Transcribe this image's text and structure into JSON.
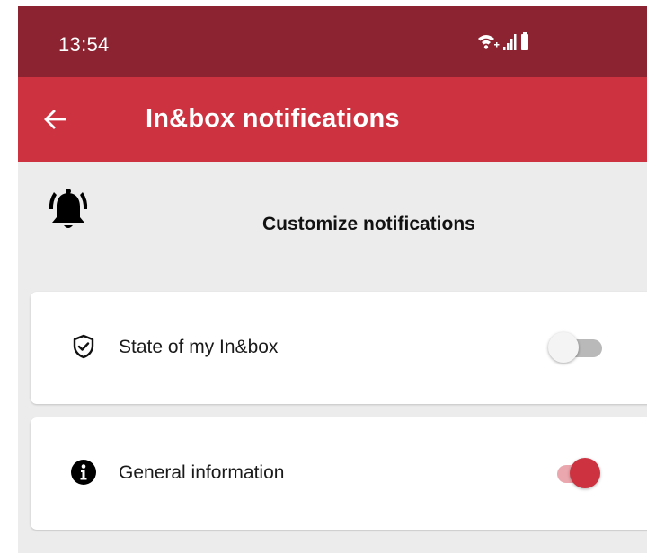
{
  "status_bar": {
    "time": "13:54",
    "icons": [
      "wifi-icon",
      "signal-icon",
      "battery-icon"
    ]
  },
  "app_bar": {
    "title": "In&box notifications",
    "back_icon": "back-arrow-icon"
  },
  "header": {
    "title": "Customize notifications",
    "icon": "bell-ringing-icon"
  },
  "settings": [
    {
      "icon": "shield-check-icon",
      "label": "State of my In&box",
      "enabled": false
    },
    {
      "icon": "info-icon",
      "label": "General information",
      "enabled": true
    }
  ],
  "colors": {
    "status_bar": "#8b2331",
    "app_bar": "#cd3240",
    "accent": "#cd3240",
    "background": "#ececec"
  }
}
